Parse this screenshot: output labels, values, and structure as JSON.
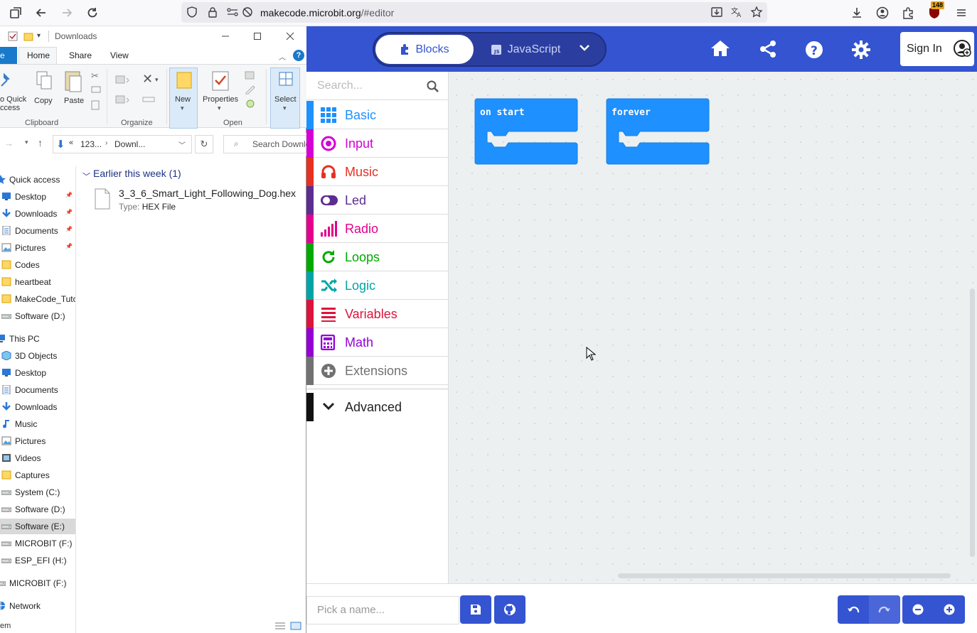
{
  "browser": {
    "url_domain": "makecode.microbit.org",
    "url_path": "/#editor",
    "extension_badge": "148"
  },
  "explorer": {
    "title": "Downloads",
    "tabs": [
      "Home",
      "Share",
      "View"
    ],
    "file_tab_label": "e",
    "ribbon": {
      "quick_access": [
        "o Quick",
        "ccess"
      ],
      "copy": "Copy",
      "paste": "Paste",
      "clipboard_group": "Clipboard",
      "organize_group": "Organize",
      "new": "New",
      "properties": "Properties",
      "open_group": "Open",
      "select": "Select"
    },
    "address": {
      "part1": "123...",
      "part2": "Downl...",
      "search_placeholder": "Search Downlo"
    },
    "nav_items": [
      {
        "label": "Quick access",
        "icon": "star-icon"
      },
      {
        "label": "Desktop",
        "icon": "desktop-icon",
        "pinned": true
      },
      {
        "label": "Downloads",
        "icon": "download-icon",
        "pinned": true
      },
      {
        "label": "Documents",
        "icon": "document-icon",
        "pinned": true
      },
      {
        "label": "Pictures",
        "icon": "pictures-icon",
        "pinned": true
      },
      {
        "label": "Codes",
        "icon": "folder-icon"
      },
      {
        "label": "heartbeat",
        "icon": "folder-icon"
      },
      {
        "label": "MakeCode_Tuto",
        "icon": "folder-icon"
      },
      {
        "label": "Software (D:)",
        "icon": "drive-icon"
      },
      {
        "label": "This PC",
        "icon": "pc-icon"
      },
      {
        "label": "3D Objects",
        "icon": "cube-icon"
      },
      {
        "label": "Desktop",
        "icon": "desktop-icon"
      },
      {
        "label": "Documents",
        "icon": "document-icon"
      },
      {
        "label": "Downloads",
        "icon": "download-icon"
      },
      {
        "label": "Music",
        "icon": "music-icon"
      },
      {
        "label": "Pictures",
        "icon": "pictures-icon"
      },
      {
        "label": "Videos",
        "icon": "video-icon"
      },
      {
        "label": "Captures",
        "icon": "folder-icon"
      },
      {
        "label": "System (C:)",
        "icon": "drive-icon"
      },
      {
        "label": "Software (D:)",
        "icon": "drive-icon"
      },
      {
        "label": "Software (E:)",
        "icon": "drive-icon",
        "selected": true
      },
      {
        "label": "MICROBIT (F:)",
        "icon": "drive-icon"
      },
      {
        "label": "ESP_EFI (H:)",
        "icon": "drive-icon"
      },
      {
        "label": "MICROBIT (F:)",
        "icon": "drive-icon"
      },
      {
        "label": "Network",
        "icon": "network-icon"
      }
    ],
    "group_header": "Earlier this week (1)",
    "file": {
      "name": "3_3_6_Smart_Light_Following_Dog.hex",
      "type_label": "Type:",
      "type_value": "HEX File"
    },
    "status_text": "em"
  },
  "makecode": {
    "modes": {
      "blocks": "Blocks",
      "javascript": "JavaScript"
    },
    "sign_in": "Sign In",
    "search_placeholder": "Search...",
    "categories": [
      {
        "label": "Basic",
        "color": "#1e90ff",
        "icon": "grid-icon"
      },
      {
        "label": "Input",
        "color": "#d400d4",
        "icon": "input-icon"
      },
      {
        "label": "Music",
        "color": "#e63022",
        "icon": "headphones-icon"
      },
      {
        "label": "Led",
        "color": "#5c2d91",
        "icon": "toggle-icon"
      },
      {
        "label": "Radio",
        "color": "#e3008c",
        "icon": "signal-icon"
      },
      {
        "label": "Loops",
        "color": "#00aa00",
        "icon": "refresh-icon"
      },
      {
        "label": "Logic",
        "color": "#00a4a6",
        "icon": "shuffle-icon"
      },
      {
        "label": "Variables",
        "color": "#dc143c",
        "icon": "list-icon"
      },
      {
        "label": "Math",
        "color": "#9400d3",
        "icon": "calculator-icon"
      },
      {
        "label": "Extensions",
        "color": "#717171",
        "icon": "plus-circle-icon"
      }
    ],
    "advanced": "Advanced",
    "blocks": [
      {
        "label": "on start"
      },
      {
        "label": "forever"
      }
    ],
    "name_placeholder": "Pick a name...",
    "colors": {
      "header": "#3454d1",
      "block": "#1e90ff"
    }
  }
}
